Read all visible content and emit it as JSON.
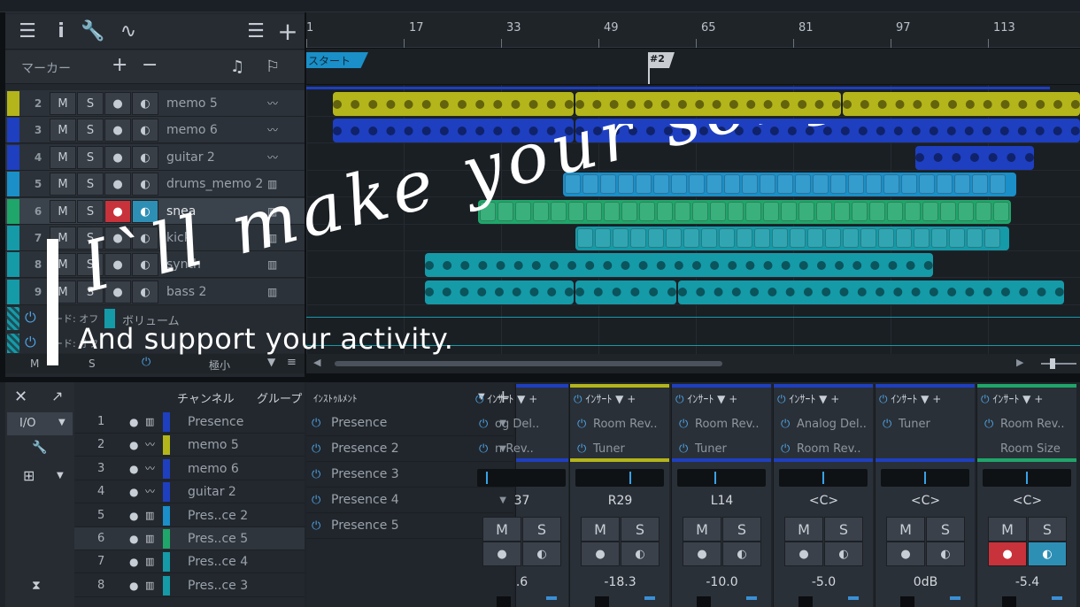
{
  "toolbar": {
    "marker_label": "マーカー",
    "add": "+",
    "remove": "−"
  },
  "ruler": {
    "ticks": [
      "1",
      "17",
      "33",
      "49",
      "65",
      "81",
      "97",
      "113"
    ]
  },
  "markers": {
    "start": "スタート",
    "m2": "#2"
  },
  "tracks": [
    {
      "num": "2",
      "name": "memo 5",
      "color": "#b4b51a",
      "icon": "wave"
    },
    {
      "num": "3",
      "name": "memo 6",
      "color": "#1e3fc0",
      "icon": "wave"
    },
    {
      "num": "4",
      "name": "guitar 2",
      "color": "#1e3fc0",
      "icon": "wave"
    },
    {
      "num": "5",
      "name": "drums_memo 2",
      "color": "#1a8fc8",
      "icon": "keys"
    },
    {
      "num": "6",
      "name": "snea",
      "color": "#1fa66a",
      "icon": "keys"
    },
    {
      "num": "7",
      "name": "kick",
      "color": "#159aa8",
      "icon": "keys"
    },
    {
      "num": "8",
      "name": "synth",
      "color": "#159aa8",
      "icon": "keys"
    },
    {
      "num": "9",
      "name": "bass 2",
      "color": "#159aa8",
      "icon": "keys"
    }
  ],
  "track_buttons": {
    "m": "M",
    "s": "S",
    "rec": "●",
    "mon": "◐"
  },
  "automation": {
    "row1_mode": "ード: オフ",
    "row1_param": "ボリューム",
    "row2_mode": "ード: オフ"
  },
  "footer": {
    "m": "M",
    "s": "S",
    "size": "極小"
  },
  "bottom": {
    "io": "I/O",
    "channel_header": "チャンネル",
    "group_header": "グループ",
    "instrument_header": "ｲﾝｽﾄｩﾙﾒﾝﾄ",
    "channels": [
      {
        "n": "1",
        "name": "Presence",
        "color": "#1e3fc0",
        "type": "keys"
      },
      {
        "n": "2",
        "name": "memo 5",
        "color": "#b4b51a",
        "type": "wave"
      },
      {
        "n": "3",
        "name": "memo 6",
        "color": "#1e3fc0",
        "type": "wave"
      },
      {
        "n": "4",
        "name": "guitar 2",
        "color": "#1e3fc0",
        "type": "wave"
      },
      {
        "n": "5",
        "name": "Pres..ce 2",
        "color": "#1a8fc8",
        "type": "keys"
      },
      {
        "n": "6",
        "name": "Pres..ce 5",
        "color": "#1fa66a",
        "type": "keys"
      },
      {
        "n": "7",
        "name": "Pres..ce 4",
        "color": "#159aa8",
        "type": "keys"
      },
      {
        "n": "8",
        "name": "Pres..ce 3",
        "color": "#159aa8",
        "type": "keys"
      }
    ],
    "instruments": [
      "Presence",
      "Presence 2",
      "Presence 3",
      "Presence 4",
      "Presence 5"
    ]
  },
  "mixer": {
    "insert_label": "ｲﾝｻｰﾄ",
    "strips": [
      {
        "color": "#1e3fc0",
        "slots": [
          "og Del..",
          "n Rev.."
        ],
        "pan_label": "37",
        "pan_pos": 0.1,
        "m": "M",
        "s": "S",
        "vol": ".6"
      },
      {
        "color": "#b4b51a",
        "slots": [
          "Room Rev..",
          "Tuner"
        ],
        "pan_label": "R29",
        "pan_pos": 0.62,
        "m": "M",
        "s": "S",
        "vol": "-18.3"
      },
      {
        "color": "#1e3fc0",
        "slots": [
          "Room Rev..",
          "Tuner"
        ],
        "pan_label": "L14",
        "pan_pos": 0.43,
        "m": "M",
        "s": "S",
        "vol": "-10.0"
      },
      {
        "color": "#1e3fc0",
        "slots": [
          "Analog Del..",
          "Room Rev.."
        ],
        "pan_label": "<C>",
        "pan_pos": 0.5,
        "m": "M",
        "s": "S",
        "vol": "-5.0"
      },
      {
        "color": "#1e3fc0",
        "slots": [
          "Tuner",
          ""
        ],
        "pan_label": "<C>",
        "pan_pos": 0.5,
        "m": "M",
        "s": "S",
        "vol": "0dB"
      },
      {
        "color": "#1fa66a",
        "slots": [
          "Room Rev..",
          "Room Size"
        ],
        "pan_label": "<C>",
        "pan_pos": 0.5,
        "m": "M",
        "s": "S",
        "vol": "-5.4"
      }
    ]
  },
  "overlay": {
    "title": "I`ll make your song!",
    "subtitle": "And support your activity."
  }
}
